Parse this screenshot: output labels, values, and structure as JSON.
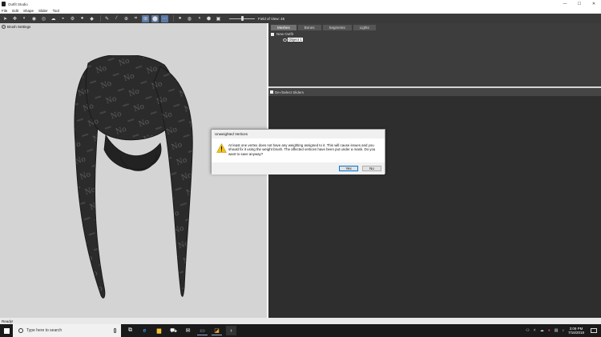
{
  "window": {
    "title": "Outfit Studio",
    "minimize": "—",
    "maximize": "☐",
    "close": "✕"
  },
  "menu": [
    "File",
    "Edit",
    "Shape",
    "Slider",
    "Tool"
  ],
  "toolbar": {
    "tools": [
      "select-tool-icon",
      "transform-tool-icon",
      "brush-mask-icon",
      "brush-inflate-icon",
      "brush-deflate-icon",
      "brush-move-icon",
      "brush-smooth-icon",
      "brush-weight-icon",
      "brush-color-icon",
      "brush-alpha-icon",
      "pick-tool-icon",
      "vertex-mode-icon",
      "edge-mode-icon",
      "face-mode-icon",
      "bone-mode-icon",
      "light-mode-icon",
      "texture-mode-icon",
      "wireframe-icon",
      "shading-icon",
      "visibility-icon",
      "camera-icon"
    ],
    "fov_label": "Field of View: 45",
    "fov_level": 0.5
  },
  "viewport": {
    "brush_settings": "Brush Settings"
  },
  "right_panel": {
    "tabs": [
      "Meshes",
      "Bones",
      "Segments",
      "Lights"
    ],
    "active_tab": "Meshes",
    "tree_root": "New Outfit",
    "tree_child": "Object 1"
  },
  "sliders_panel": {
    "header": "De-/Select Sliders"
  },
  "status": {
    "text": "Ready!"
  },
  "dialog": {
    "title": "Unweighted Vertices",
    "message": "At least one vertex does not have any weighting assigned to it. This will cause issues and you should fix it using the weight brush. The affected vertices have been put under a mask. Do you want to save anyway?",
    "yes": "Yes",
    "no": "No"
  },
  "taskbar": {
    "search_placeholder": "Type here to search",
    "apps": [
      "task-view-icon",
      "edge-icon",
      "file-explorer-icon",
      "store-icon",
      "mail-icon",
      "app-icon",
      "outfit-studio-icon",
      "terminal-icon"
    ],
    "time": "3:09 PM",
    "date": "7/16/2018"
  },
  "colors": {
    "accent": "#0078d7",
    "toolbar": "#3a3a3a",
    "panel": "#3d3d3d"
  }
}
